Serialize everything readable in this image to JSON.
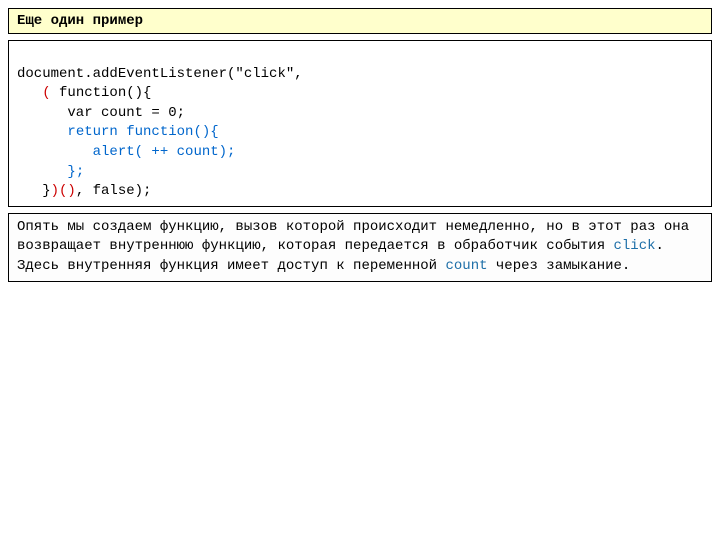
{
  "title": "Еще один пример",
  "code": {
    "l1a": "document.addEventListener(\"click\",",
    "l2a": "   ",
    "l2b": "(",
    "l2c": " function(){",
    "l3": "      var count = 0;",
    "l4a": "      ",
    "l4b": "return function(){",
    "l5a": "         ",
    "l5b": "alert( ++ count);",
    "l6a": "      ",
    "l6b": "};",
    "l7a": "   }",
    "l7b": ")()",
    "l7c": ", false);"
  },
  "expl": {
    "p1a": "Опять мы создаем функцию, вызов которой происходит немедленно, но в этот раз она возвращает внутреннюю функцию, которая передается в обработчик события ",
    "p1b": "click",
    "p1c": ".",
    "p2a": "Здесь внутренняя функция имеет доступ к переменной ",
    "p2b": "count",
    "p2c": " через замыкание."
  }
}
